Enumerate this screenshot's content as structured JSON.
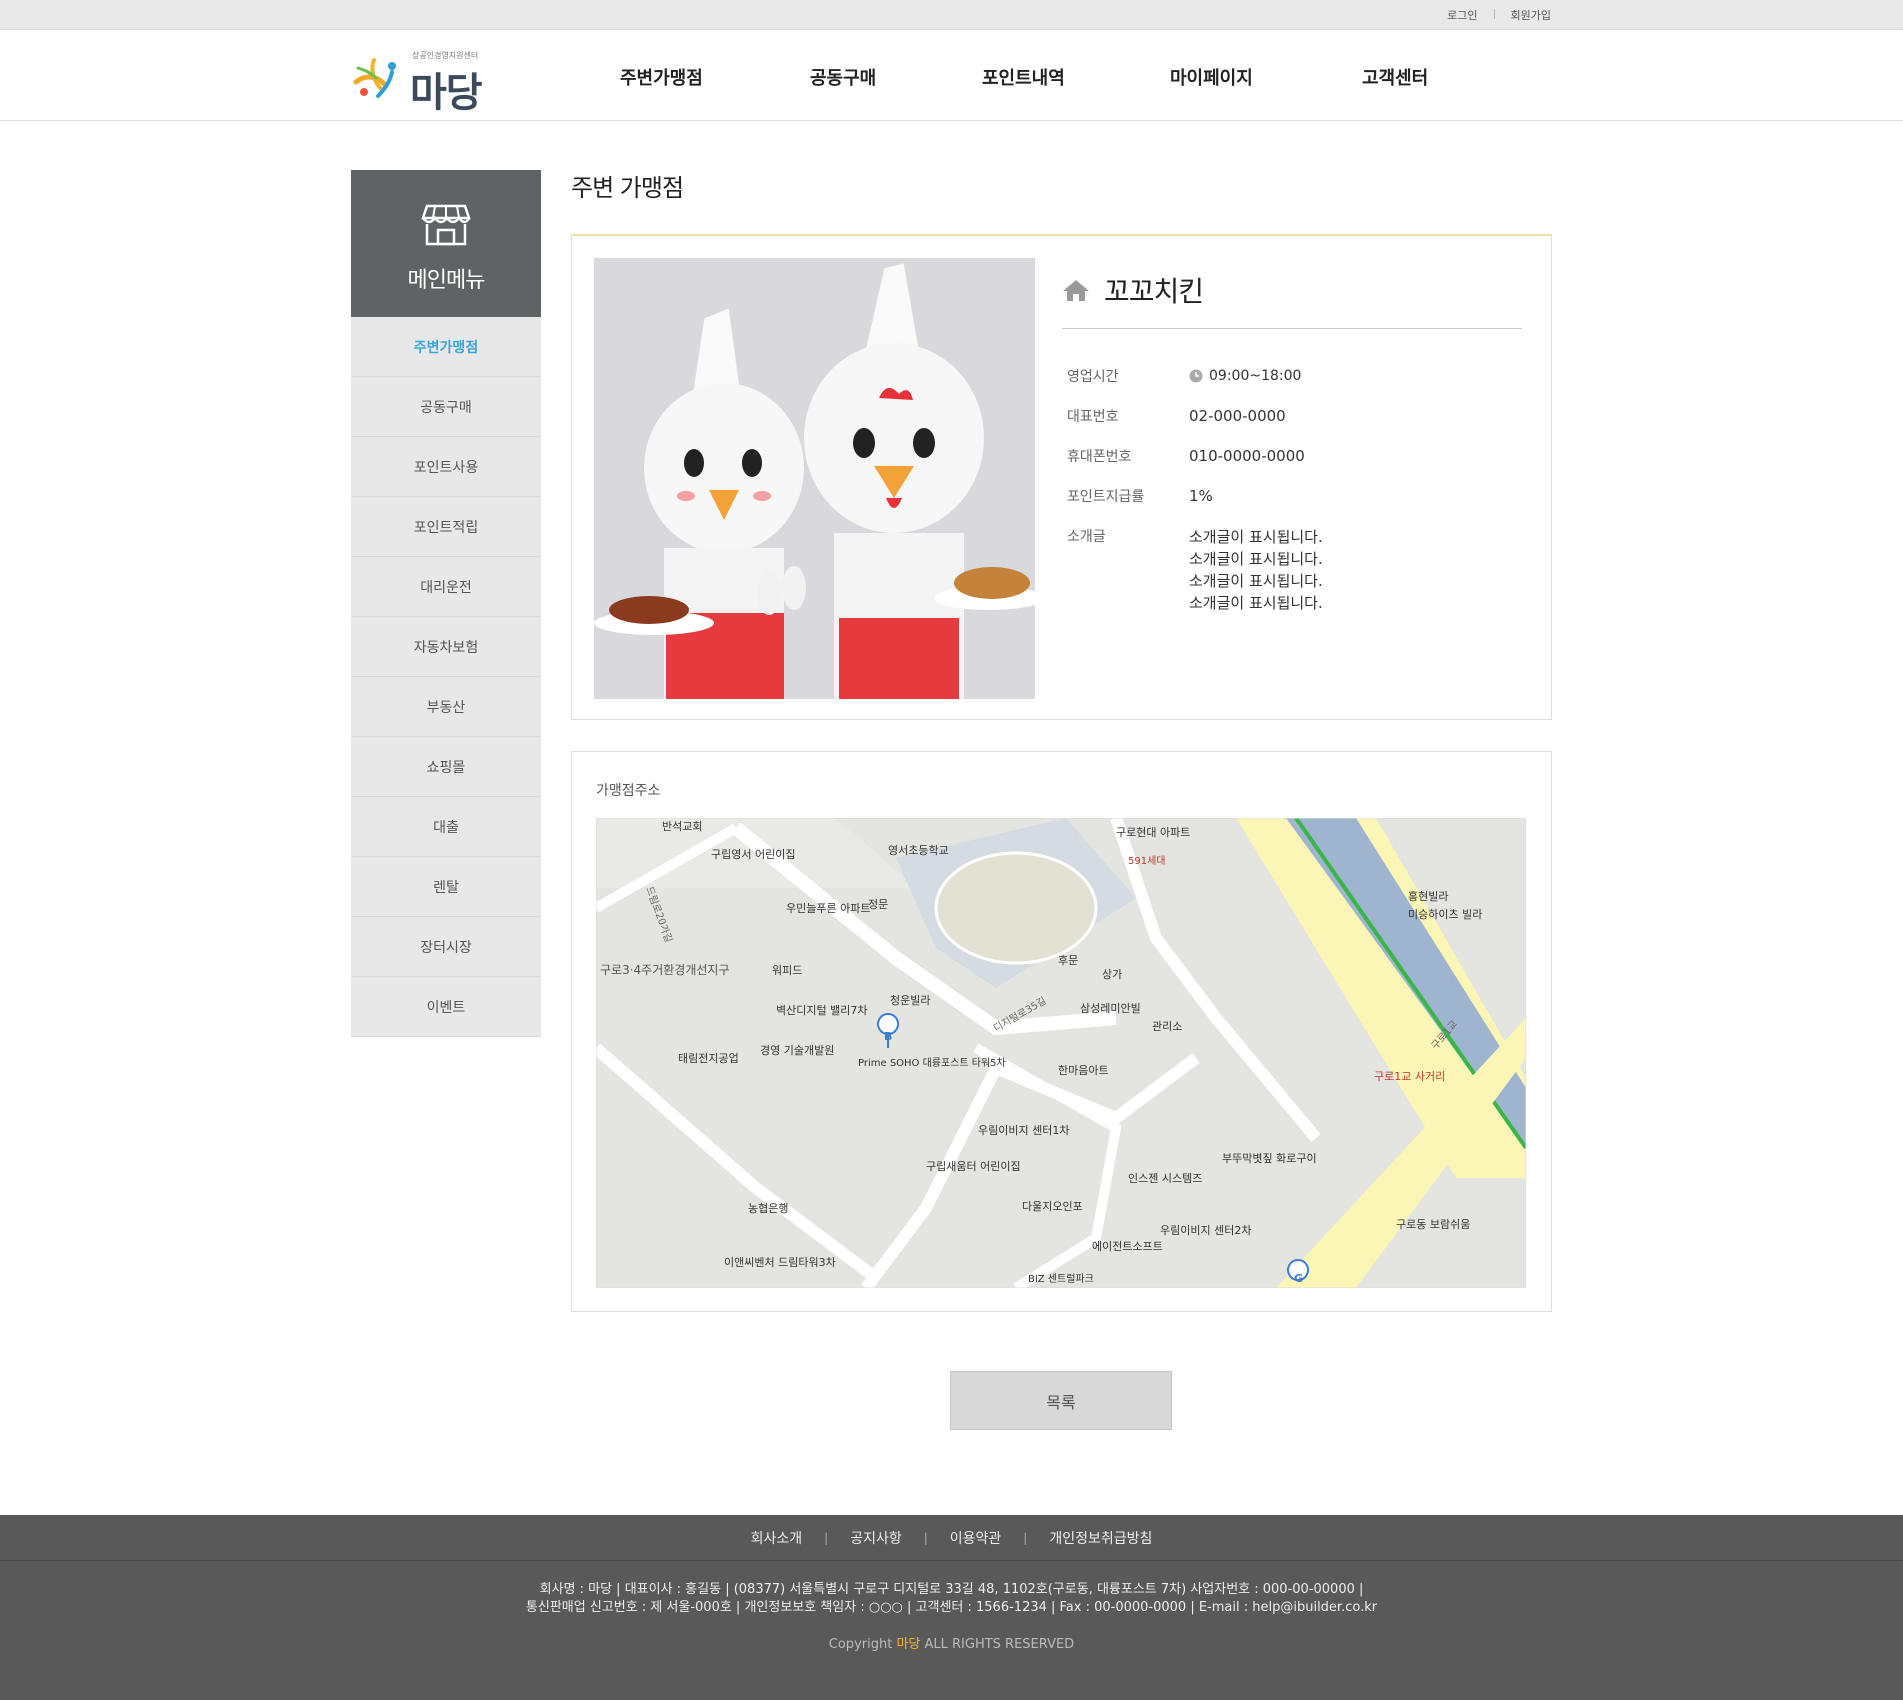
{
  "topbar": {
    "login": "로그인",
    "signup": "회원가입"
  },
  "header": {
    "logo_small": "상공인경영지원센터",
    "logo_big": "마당",
    "nav": [
      "주변가맹점",
      "공동구매",
      "포인트내역",
      "마이페이지",
      "고객센터"
    ]
  },
  "sidebar": {
    "title": "메인메뉴",
    "items": [
      "주변가맹점",
      "공동구매",
      "포인트사용",
      "포인트적립",
      "대리운전",
      "자동차보험",
      "부동산",
      "쇼핑몰",
      "대출",
      "렌탈",
      "장터시장",
      "이벤트"
    ],
    "active_index": 0
  },
  "page": {
    "title": "주변 가맹점"
  },
  "store": {
    "name": "꼬꼬치킨",
    "hours_label": "영업시간",
    "hours": "09:00~18:00",
    "phone_label": "대표번호",
    "phone": "02-000-0000",
    "mobile_label": "휴대폰번호",
    "mobile": "010-0000-0000",
    "point_label": "포인트지급률",
    "point": "1%",
    "intro_label": "소개글",
    "intro": [
      "소개글이 표시됩니다.",
      "소개글이 표시됩니다.",
      "소개글이 표시됩니다.",
      "소개글이 표시됩니다."
    ]
  },
  "map": {
    "label": "가맹점주소",
    "places": [
      "반석교회",
      "구립영서 어린이집",
      "영서초등학교",
      "구로현대 아파트",
      "591세대",
      "우민늘푸른 아파트",
      "정문",
      "홍현빌라",
      "미승하이츠 빌라",
      "구로3·4주거환경개선지구",
      "워피드",
      "청운빌라",
      "후문",
      "상가",
      "벽산디지털 밸리7차",
      "삼성레미안빌",
      "관리소",
      "경영 기술개발원",
      "태림전지공업",
      "Prime SOHO 대륭포스트 타워5차",
      "한마음아트",
      "구로1교 사거리",
      "우림이비지 센터1차",
      "구립새움터 어린이집",
      "인스젠 시스템즈",
      "부뚜막볏짚 화로구이",
      "농협은행",
      "다울지오인포",
      "우림이비지 센터2차",
      "에이전트소프트",
      "구로동 보람쉬움",
      "이앤씨벤처 드림타워3차",
      "BIZ 센트럴파크",
      "디지털로35길",
      "드림로20가길",
      "구로1교"
    ]
  },
  "buttons": {
    "list": "목록"
  },
  "footer": {
    "nav": [
      "회사소개",
      "공지사항",
      "이용약관",
      "개인정보취급방침"
    ],
    "line1": "회사명 : 마당 | 대표이사 : 홍길동 | (08377) 서울특별시 구로구 디지털로 33길 48, 1102호(구로동, 대륭포스트 7차) 사업자번호 : 000-00-00000 |",
    "line2": "통신판매업 신고번호 : 제 서울-000호 | 개인정보보호 책임자 : ○○○ | 고객센터 : 1566-1234 | Fax : 00-0000-0000 | E-mail : help@ibuilder.co.kr",
    "copy_prefix": "Copyright ",
    "copy_brand": "마당",
    "copy_suffix": " ALL RIGHTS RESERVED"
  },
  "colors": {
    "accent": "#3aa6d8",
    "sidebar_head": "#5f6366",
    "footer_bg": "#595959",
    "brand": "#f3b331"
  }
}
